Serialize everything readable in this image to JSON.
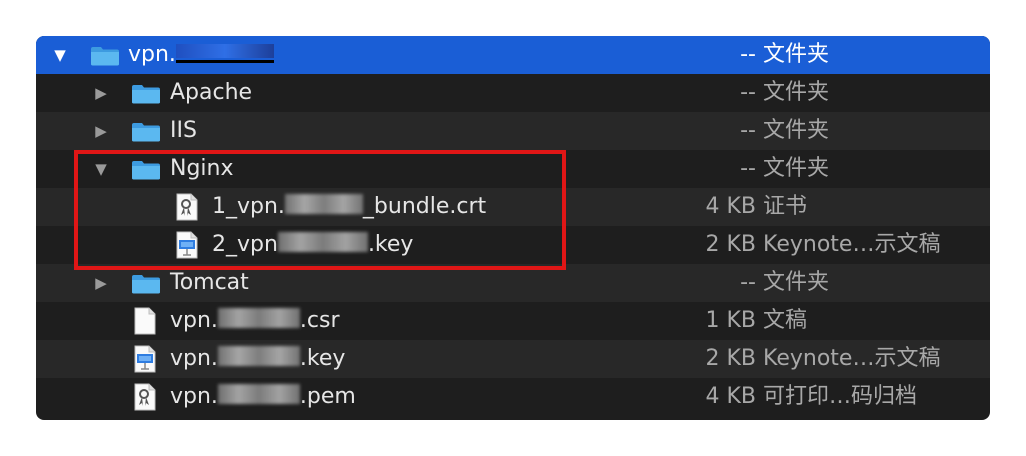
{
  "rows": [
    {
      "name": "vpn.",
      "size": "--",
      "kind": "文件夹",
      "icon": "folder-icon",
      "expanded": true
    },
    {
      "name": "Apache",
      "size": "--",
      "kind": "文件夹",
      "icon": "folder-icon",
      "expanded": false
    },
    {
      "name": "IIS",
      "size": "--",
      "kind": "文件夹",
      "icon": "folder-icon",
      "expanded": false
    },
    {
      "name": "Nginx",
      "size": "--",
      "kind": "文件夹",
      "icon": "folder-icon",
      "expanded": true
    },
    {
      "name_prefix": "1_vpn.",
      "name_suffix": "_bundle.crt",
      "size": "4 KB",
      "kind": "证书",
      "icon": "certificate-icon"
    },
    {
      "name_prefix": "2_vpn",
      "name_suffix": ".key",
      "size": "2 KB",
      "kind": "Keynote…示文稿",
      "icon": "keynote-icon"
    },
    {
      "name": "Tomcat",
      "size": "--",
      "kind": "文件夹",
      "icon": "folder-icon",
      "expanded": false
    },
    {
      "name_prefix": "vpn.",
      "name_suffix": ".csr",
      "size": "1 KB",
      "kind": "文稿",
      "icon": "document-icon"
    },
    {
      "name_prefix": "vpn.",
      "name_suffix": ".key",
      "size": "2 KB",
      "kind": "Keynote…示文稿",
      "icon": "keynote-icon"
    },
    {
      "name_prefix": "vpn.",
      "name_suffix": ".pem",
      "size": "4 KB",
      "kind": "可打印…码归档",
      "icon": "certificate-icon"
    }
  ],
  "colors": {
    "selection": "#1a5ed6",
    "highlight_box": "#e01616",
    "folder": "#5bb8f0"
  }
}
